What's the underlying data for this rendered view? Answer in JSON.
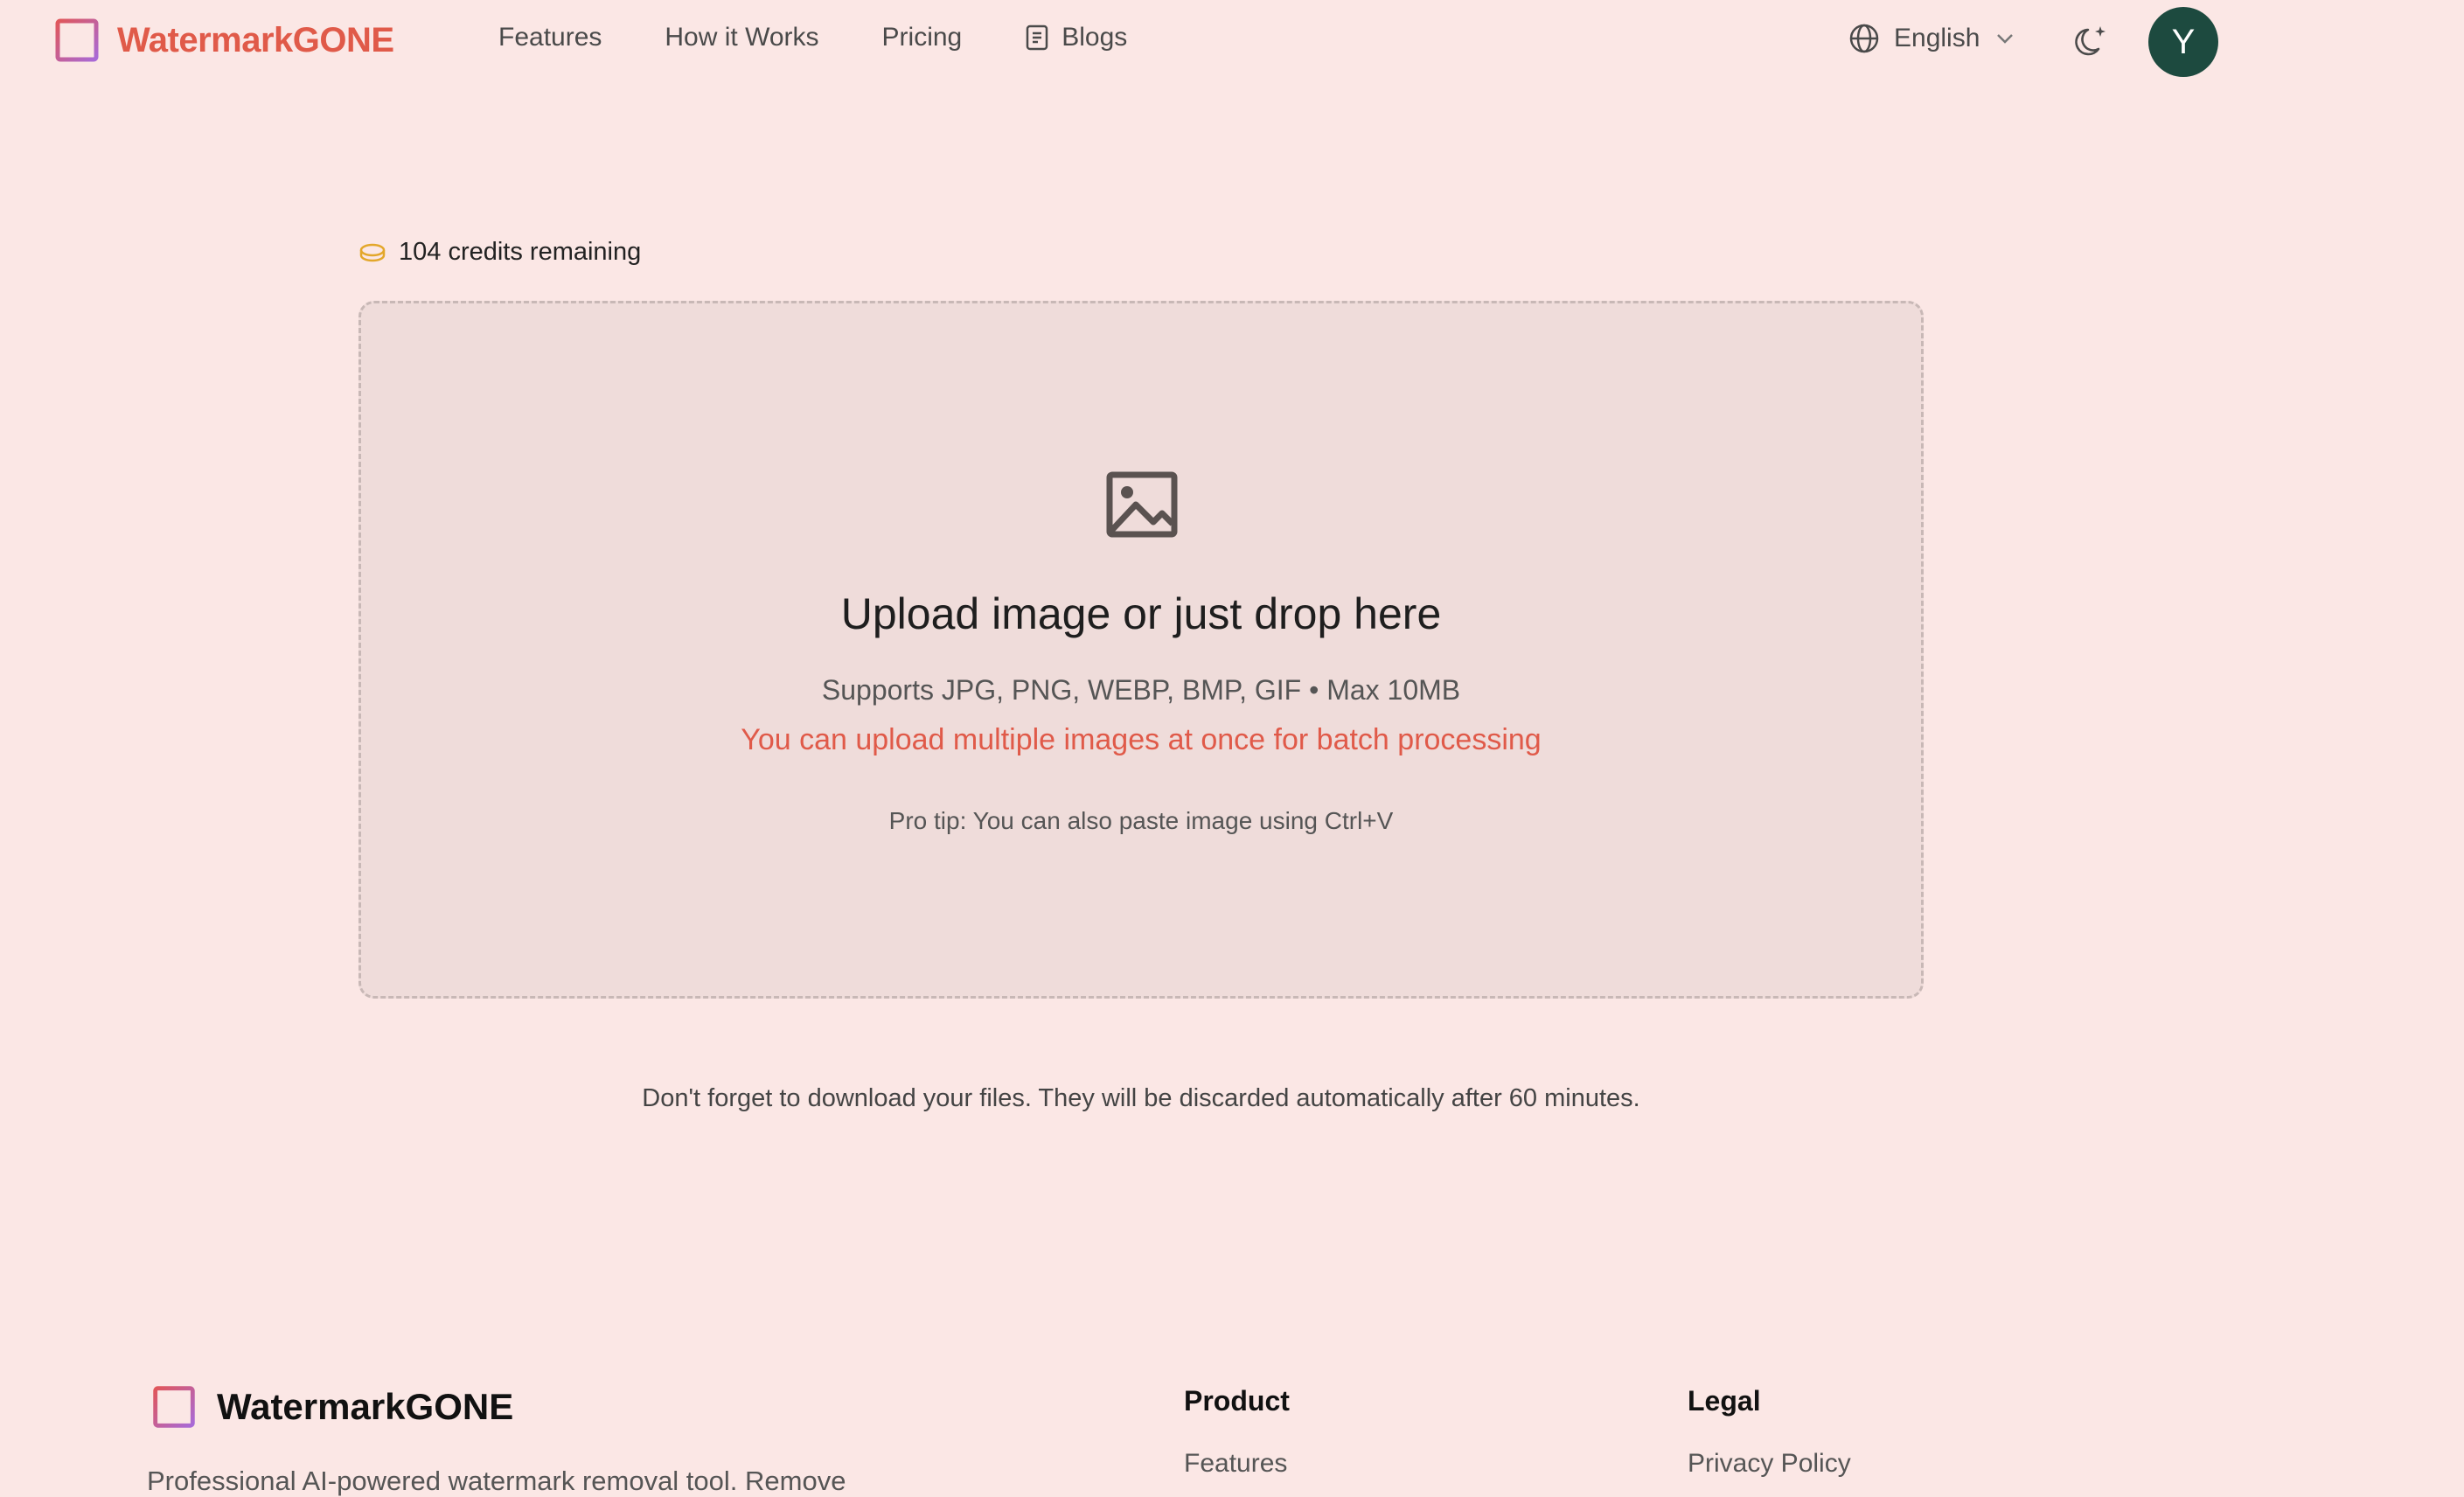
{
  "header": {
    "brand": "WatermarkGONE",
    "nav": [
      {
        "label": "Features"
      },
      {
        "label": "How it Works"
      },
      {
        "label": "Pricing"
      },
      {
        "label": "Blogs",
        "icon": "document-icon"
      }
    ],
    "language": "English",
    "avatar_initial": "Y"
  },
  "credits": {
    "text": "104 credits remaining",
    "icon": "coin-icon"
  },
  "dropzone": {
    "title": "Upload image or just drop here",
    "supports": "Supports JPG, PNG, WEBP, BMP, GIF • Max 10MB",
    "batch": "You can upload multiple images at once for batch processing",
    "tip": "Pro tip: You can also paste image using Ctrl+V"
  },
  "notice": "Don't forget to download your files. They will be discarded automatically after 60 minutes.",
  "footer": {
    "brand": "WatermarkGONE",
    "description": "Professional AI-powered watermark removal tool. Remove",
    "columns": [
      {
        "heading": "Product",
        "links": [
          "Features"
        ]
      },
      {
        "heading": "Legal",
        "links": [
          "Privacy Policy"
        ]
      }
    ]
  },
  "colors": {
    "accent": "#e05a49",
    "background": "#fbe7e5",
    "dropzone": "#efdcda",
    "avatar": "#1d4a3f"
  }
}
